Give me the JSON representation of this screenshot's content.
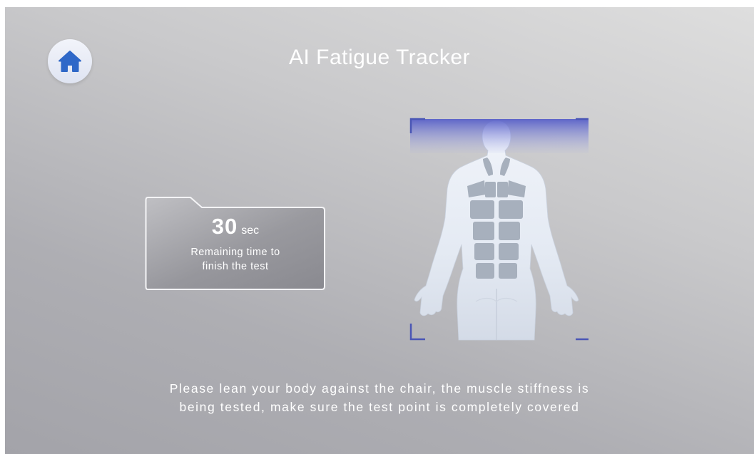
{
  "header": {
    "title": "AI Fatigue Tracker",
    "home_icon": "home-icon"
  },
  "timer": {
    "value": "30",
    "unit": "sec",
    "caption_line1": "Remaining time to",
    "caption_line2": "finish the test"
  },
  "scanner": {
    "figure": "human-back-figure",
    "frame_color": "#4a56b5",
    "scan_band_color": "#5860c8"
  },
  "instruction": {
    "line1": "Please lean your body against the chair, the muscle stiffness is",
    "line2": "being tested, make sure the test point is completely covered"
  },
  "colors": {
    "accent": "#2f68c8",
    "text": "#ffffff",
    "background_light": "#dedede",
    "background_dark": "#a3a3a9"
  }
}
